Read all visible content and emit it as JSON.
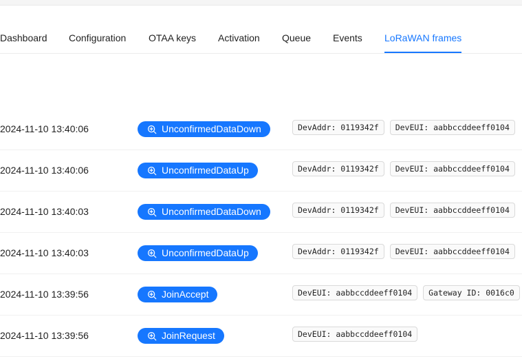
{
  "tabs": [
    {
      "label": "Dashboard"
    },
    {
      "label": "Configuration"
    },
    {
      "label": "OTAA keys"
    },
    {
      "label": "Activation"
    },
    {
      "label": "Queue"
    },
    {
      "label": "Events"
    },
    {
      "label": "LoRaWAN frames",
      "active": true
    }
  ],
  "frames": [
    {
      "timestamp": "2024-11-10 13:40:06",
      "type": "UnconfirmedDataDown",
      "tags": [
        "DevAddr: 0119342f",
        "DevEUI: aabbccddeeff0104"
      ]
    },
    {
      "timestamp": "2024-11-10 13:40:06",
      "type": "UnconfirmedDataUp",
      "tags": [
        "DevAddr: 0119342f",
        "DevEUI: aabbccddeeff0104"
      ]
    },
    {
      "timestamp": "2024-11-10 13:40:03",
      "type": "UnconfirmedDataDown",
      "tags": [
        "DevAddr: 0119342f",
        "DevEUI: aabbccddeeff0104"
      ]
    },
    {
      "timestamp": "2024-11-10 13:40:03",
      "type": "UnconfirmedDataUp",
      "tags": [
        "DevAddr: 0119342f",
        "DevEUI: aabbccddeeff0104"
      ]
    },
    {
      "timestamp": "2024-11-10 13:39:56",
      "type": "JoinAccept",
      "tags": [
        "DevEUI: aabbccddeeff0104",
        "Gateway ID: 0016c0"
      ]
    },
    {
      "timestamp": "2024-11-10 13:39:56",
      "type": "JoinRequest",
      "tags": [
        "DevEUI: aabbccddeeff0104"
      ]
    }
  ],
  "icons": {
    "type_button_icon": "zoom-in-icon"
  },
  "colors": {
    "accent": "#1677ff",
    "tag_background": "#fafafa",
    "tag_border": "#d9d9d9"
  }
}
